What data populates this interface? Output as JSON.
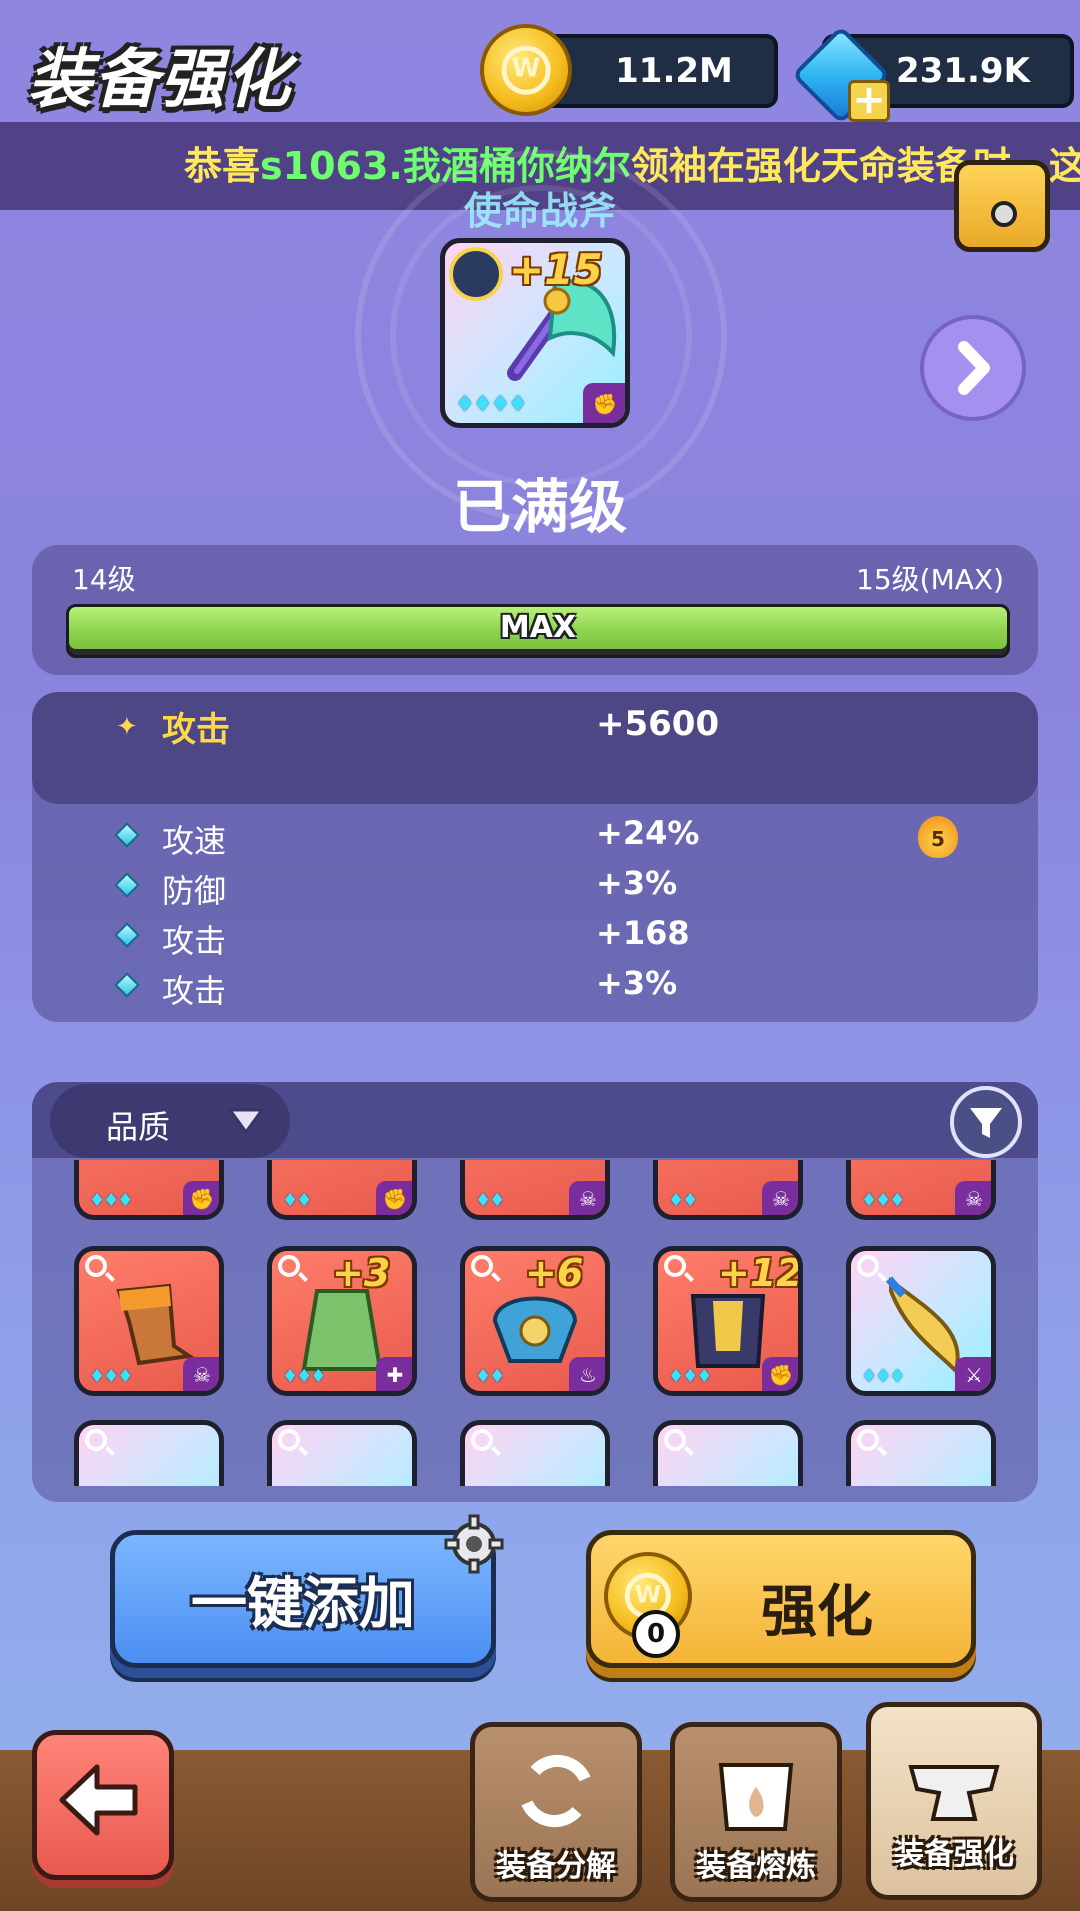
{
  "header": {
    "title": "装备强化",
    "coins": "11.2M",
    "gems": "231.9K"
  },
  "ticker": {
    "part1": "恭喜",
    "player": "s1063.我酒桶你纳尔",
    "part2": "领袖在强化天命装备时，这"
  },
  "item": {
    "name": "使命战斧",
    "level_badge": "+15",
    "status": "已满级"
  },
  "progress": {
    "current_level": "14级",
    "max_level": "15级(MAX)",
    "bar_text": "MAX",
    "fill": 1.0
  },
  "stats": {
    "main": {
      "name": "攻击",
      "value": "+5600"
    },
    "subs": [
      {
        "name": "攻速",
        "value": "+24%",
        "badge": "5"
      },
      {
        "name": "防御",
        "value": "+3%"
      },
      {
        "name": "攻击",
        "value": "+168"
      },
      {
        "name": "攻击",
        "value": "+3%"
      }
    ]
  },
  "inventory": {
    "sort_label": "品质",
    "row_cards": [
      {
        "plus": ""
      },
      {
        "plus": "+3"
      },
      {
        "plus": "+6"
      },
      {
        "plus": "+12"
      },
      {
        "plus": ""
      }
    ]
  },
  "actions": {
    "auto_add": "一键添加",
    "enhance": "强化",
    "cost": "0"
  },
  "tabs": [
    {
      "label": "装备分解"
    },
    {
      "label": "装备熔炼"
    },
    {
      "label": "装备强化"
    }
  ],
  "colors": {
    "accent_gold": "#f4b437",
    "accent_blue": "#4b8ff2",
    "ticker_player": "#6dff6d",
    "ticker_text": "#ffe85a"
  },
  "icons": {
    "coin": "coin-icon",
    "gem": "gem-icon",
    "back": "back-arrow-icon",
    "filter": "filter-icon",
    "settings": "gear-icon"
  }
}
